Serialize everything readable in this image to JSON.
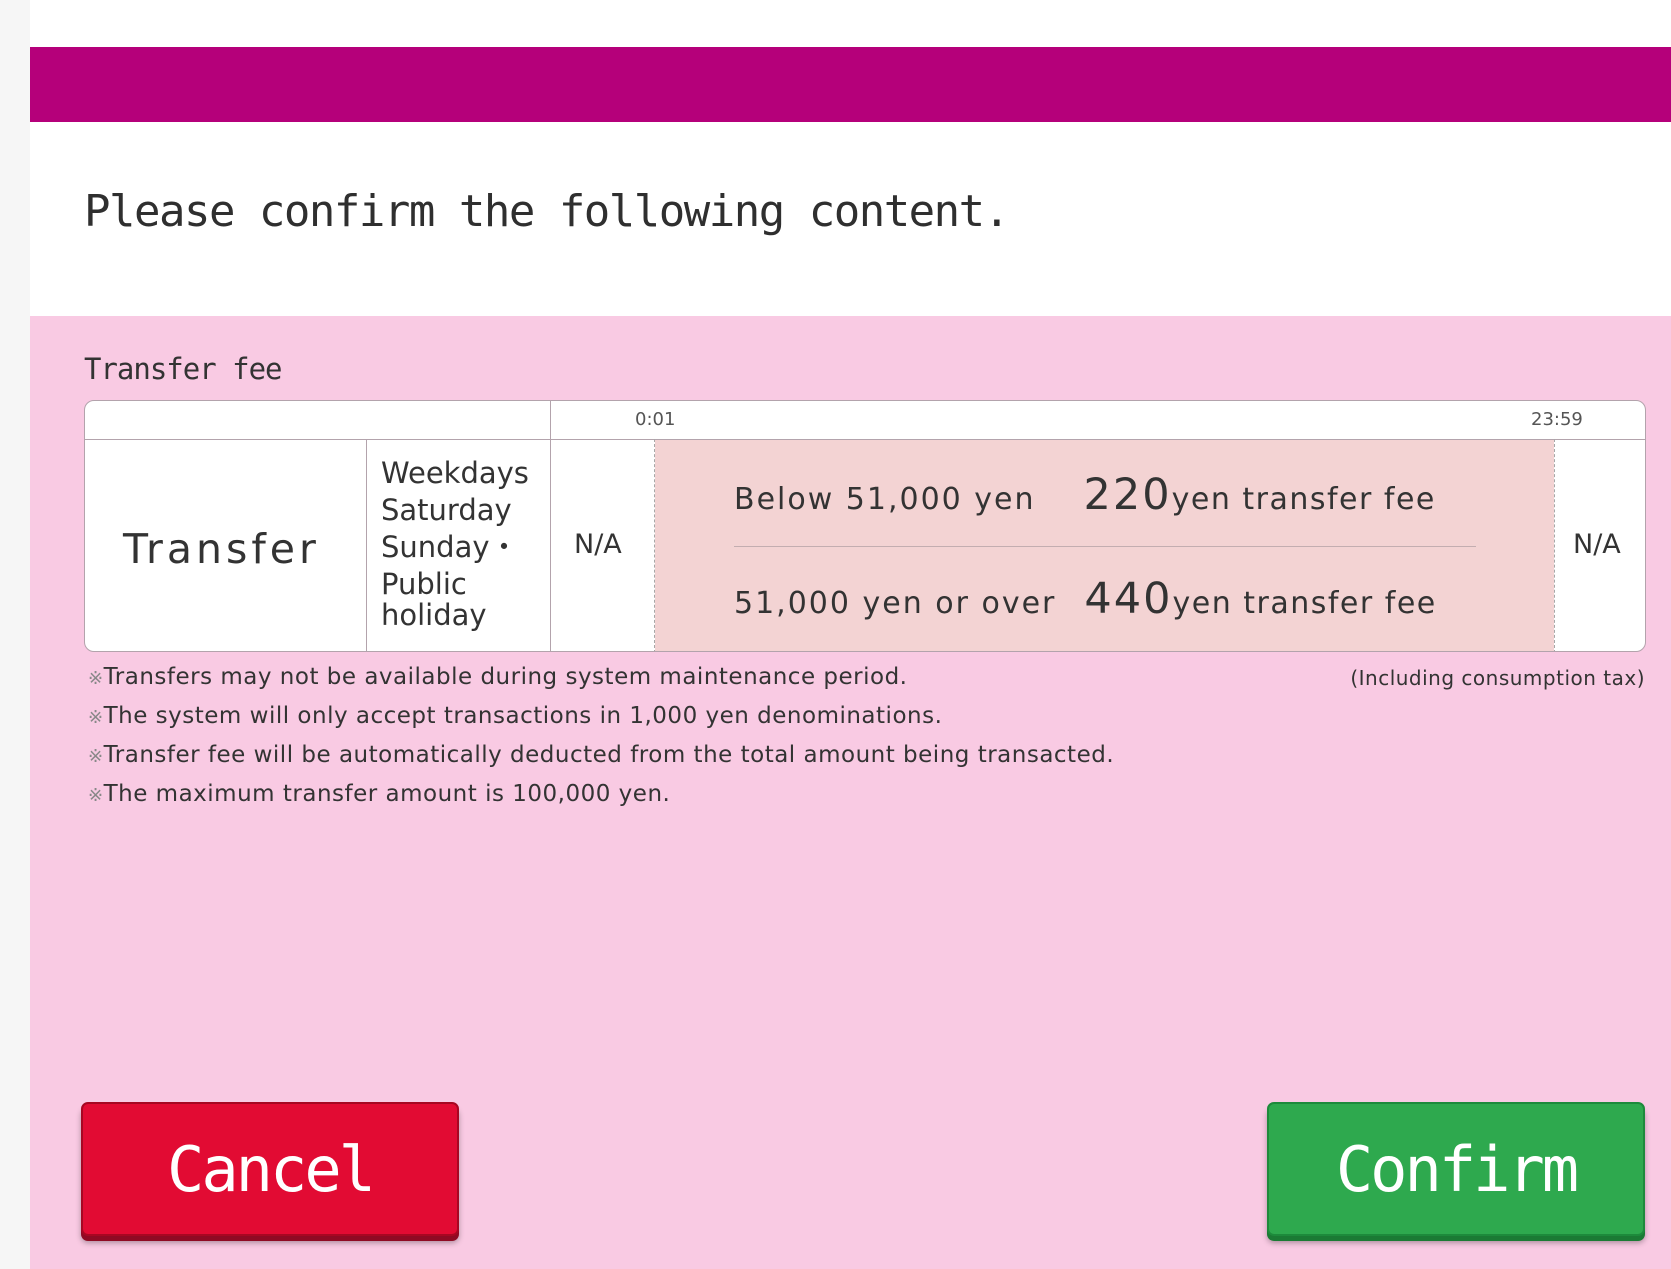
{
  "header": {
    "title": "Please confirm the following content."
  },
  "fee_section": {
    "label": "Transfer fee",
    "time_start": "0:01",
    "time_end": "23:59",
    "service": "Transfer",
    "days": [
      "Weekdays",
      "Saturday",
      "Sunday・",
      "Public",
      "holiday"
    ],
    "na_before": "N/A",
    "na_after": "N/A",
    "tiers": [
      {
        "condition": "Below 51,000 yen",
        "amount": "220",
        "unit": "yen transfer fee"
      },
      {
        "condition": "51,000 yen or over",
        "amount": "440",
        "unit": "yen transfer fee"
      }
    ],
    "tax_note": "(Including consumption tax)"
  },
  "notes": {
    "mark": "※",
    "items": [
      "Transfers may not be available during system maintenance period.",
      "The system will only accept transactions in 1,000 yen denominations.",
      "Transfer fee will be automatically deducted from the total amount being transacted.",
      "The maximum transfer amount is 100,000 yen."
    ]
  },
  "buttons": {
    "cancel": "Cancel",
    "confirm": "Confirm"
  },
  "colors": {
    "top_bar": "#b5007a",
    "content_bg": "#f9cae3",
    "fee_band": "#f3d3d3",
    "cancel": "#e20b33",
    "confirm": "#2ea94e"
  }
}
